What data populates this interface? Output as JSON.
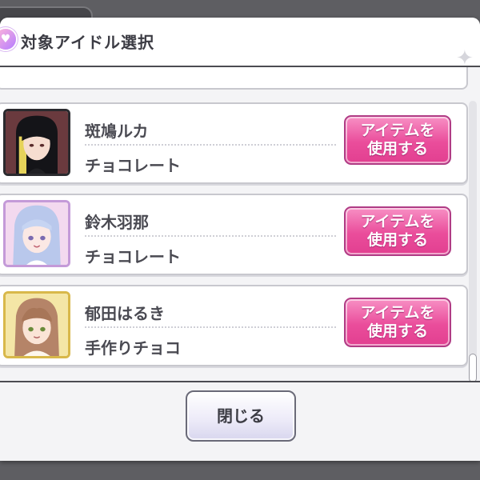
{
  "dialog": {
    "title": "対象アイドル選択",
    "header_icon": "heart-chocolate-icon",
    "close_label": "閉じる"
  },
  "idols": [
    {
      "name": "斑鳩ルカ",
      "item": "チョコレート",
      "button_line1": "アイテムを",
      "button_line2": "使用する",
      "avatar_frame": "#2a2a2e"
    },
    {
      "name": "鈴木羽那",
      "item": "チョコレート",
      "button_line1": "アイテムを",
      "button_line2": "使用する",
      "avatar_frame": "#c49ad8"
    },
    {
      "name": "郁田はるき",
      "item": "手作りチョコ",
      "button_line1": "アイテムを",
      "button_line2": "使用する",
      "avatar_frame": "#d8b84a"
    }
  ],
  "colors": {
    "use_button": "#ea4d9b",
    "close_button": "#eceaf8",
    "frame": "#4c4c52"
  }
}
